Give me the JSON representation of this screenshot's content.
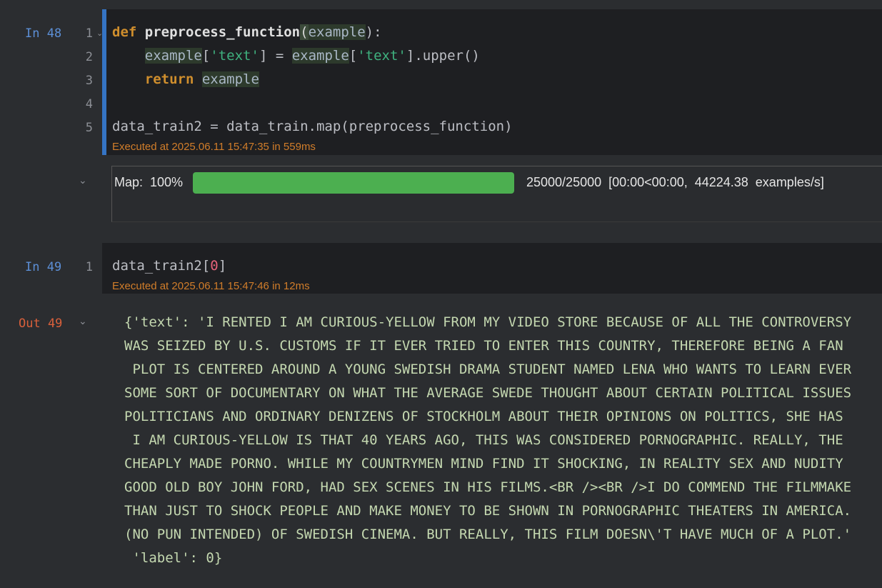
{
  "cell48": {
    "prompt": "In 48",
    "line_numbers": [
      "1",
      "2",
      "3",
      "4",
      "5"
    ],
    "code": {
      "l1_def": "def",
      "l1_name": "preprocess_function",
      "l1_open": "(",
      "l1_param": "example",
      "l1_close": "):",
      "l2_indent": "    ",
      "l2_var": "example",
      "l2_open": "[",
      "l2_key": "'text'",
      "l2_mid": "] = ",
      "l2_var2": "example",
      "l2_open2": "[",
      "l2_key2": "'text'",
      "l2_end": "].upper()",
      "l3_indent": "    ",
      "l3_ret": "return",
      "l3_sp": " ",
      "l3_var": "example",
      "l5": "data_train2 = data_train.map(preprocess_function)"
    },
    "executed": "Executed at 2025.06.11 15:47:35 in 559ms"
  },
  "progress": {
    "label": "Map:  100%",
    "fraction": 1.0,
    "stats": "25000/25000  [00:00<00:00,  44224.38  examples/s]"
  },
  "cell49": {
    "prompt": "In 49",
    "line_numbers": [
      "1"
    ],
    "code": {
      "var": "data_train2",
      "open": "[",
      "index": "0",
      "close": "]"
    },
    "executed": "Executed at 2025.06.11 15:47:46 in 12ms"
  },
  "out49": {
    "prompt": "Out 49",
    "lines": [
      "{'text': 'I RENTED I AM CURIOUS-YELLOW FROM MY VIDEO STORE BECAUSE OF ALL THE CONTROVERSY",
      "WAS SEIZED BY U.S. CUSTOMS IF IT EVER TRIED TO ENTER THIS COUNTRY, THEREFORE BEING A FAN",
      " PLOT IS CENTERED AROUND A YOUNG SWEDISH DRAMA STUDENT NAMED LENA WHO WANTS TO LEARN EVER",
      "SOME SORT OF DOCUMENTARY ON WHAT THE AVERAGE SWEDE THOUGHT ABOUT CERTAIN POLITICAL ISSUES",
      "POLITICIANS AND ORDINARY DENIZENS OF STOCKHOLM ABOUT THEIR OPINIONS ON POLITICS, SHE HAS",
      " I AM CURIOUS-YELLOW IS THAT 40 YEARS AGO, THIS WAS CONSIDERED PORNOGRAPHIC. REALLY, THE",
      "CHEAPLY MADE PORNO. WHILE MY COUNTRYMEN MIND FIND IT SHOCKING, IN REALITY SEX AND NUDITY",
      "GOOD OLD BOY JOHN FORD, HAD SEX SCENES IN HIS FILMS.<BR /><BR />I DO COMMEND THE FILMMAKE",
      "THAN JUST TO SHOCK PEOPLE AND MAKE MONEY TO BE SHOWN IN PORNOGRAPHIC THEATERS IN AMERICA.",
      "(NO PUN INTENDED) OF SWEDISH CINEMA. BUT REALLY, THIS FILM DOESN\\'T HAVE MUCH OF A PLOT.'",
      " 'label': 0}"
    ]
  }
}
